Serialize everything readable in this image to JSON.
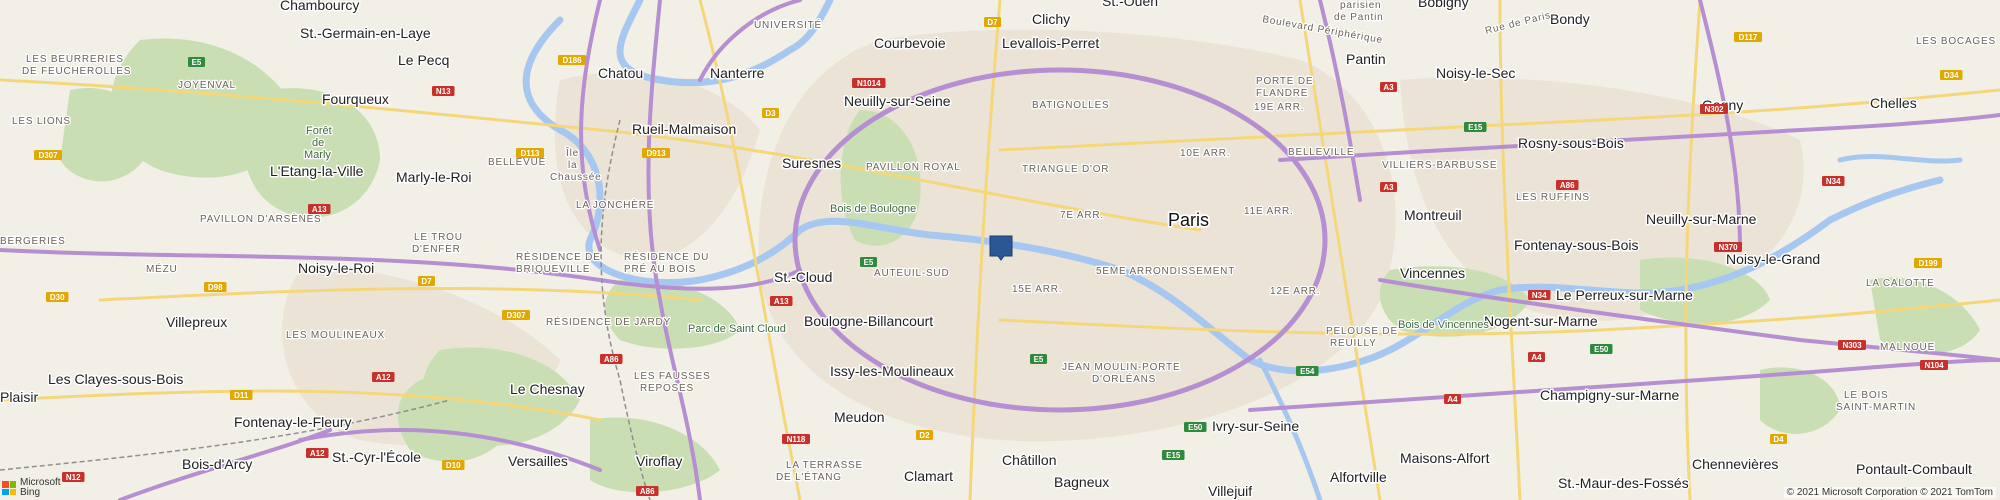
{
  "map": {
    "cities": {
      "paris": "Paris",
      "chambourcy": "Chambourcy",
      "st_germain": "St.-Germain-en-Laye",
      "le_pecq": "Le Pecq",
      "fourqueux": "Fourqueux",
      "letang": "L'Etang-la-Ville",
      "marly": "Marly-le-Roi",
      "chatou": "Chatou",
      "nanterre": "Nanterre",
      "courbevoie": "Courbevoie",
      "clichy": "Clichy",
      "st_ouen": "St.-Ouen",
      "levallois": "Levallois-Perret",
      "neuilly_seine": "Neuilly-sur-Seine",
      "rueil": "Rueil-Malmaison",
      "suresnes": "Suresnes",
      "st_cloud": "St.-Cloud",
      "boulogne": "Boulogne-Billancourt",
      "issy": "Issy-les-Moulineaux",
      "meudon": "Meudon",
      "clamart": "Clamart",
      "chatillon": "Châtillon",
      "bagneux": "Bagneux",
      "villejuif": "Villejuif",
      "ivry": "Ivry-sur-Seine",
      "alfortville": "Alfortville",
      "maisons_alfort": "Maisons-Alfort",
      "vincennes": "Vincennes",
      "montreuil": "Montreuil",
      "pantin": "Pantin",
      "noisy_sec": "Noisy-le-Sec",
      "bobigny": "Bobigny",
      "bondy": "Bondy",
      "rosny": "Rosny-sous-Bois",
      "gagny": "Gagny",
      "chelles": "Chelles",
      "neuilly_marne": "Neuilly-sur-Marne",
      "fontenay_bois": "Fontenay-sous-Bois",
      "noisy_grand": "Noisy-le-Grand",
      "perreux": "Le Perreux-sur-Marne",
      "nogent": "Nogent-sur-Marne",
      "champigny": "Champigny-sur-Marne",
      "chennevieres": "Chennevières",
      "st_maur": "St.-Maur-des-Fossés",
      "pontault": "Pontault-Combault",
      "noisy_roi": "Noisy-le-Roi",
      "villepreux": "Villepreux",
      "clayes": "Les Clayes-sous-Bois",
      "plaisir": "Plaisir",
      "fontenay_fleury": "Fontenay-le-Fleury",
      "bois_arcy": "Bois-d'Arcy",
      "st_cyr": "St.-Cyr-l'École",
      "versailles": "Versailles",
      "viroflay": "Viroflay",
      "le_chesnay": "Le Chesnay"
    },
    "districts": {
      "universite": "UNIVERSITÉ",
      "beurreries": "LES BEURRERIES",
      "feucherolles": "DE FEUCHEROLLES",
      "joyenval": "JOYENVAL",
      "les_lions": "LES LIONS",
      "bergeries": "BERGERIES",
      "bellevue": "BELLEVUE",
      "chaussee_1": "Île",
      "chaussee_2": "la",
      "chaussee_3": "Chaussée",
      "pavillon_royal": "PAVILLON ROYAL",
      "triangle_or": "TRIANGLE D'OR",
      "batignolles": "BATIGNOLLES",
      "arr10": "10E ARR.",
      "arr19": "19E ARR.",
      "belleville": "BELLEVILLE",
      "arr11": "11E ARR.",
      "arr7": "7E ARR.",
      "arr12": "12E ARR.",
      "arr15": "15E ARR.",
      "arr5": "5EME ARRONDISSEMENT",
      "auteuil": "AUTEUIL-SUD",
      "jean_moulin_1": "JEAN MOULIN-PORTE",
      "jean_moulin_2": "D'ORLÉANS",
      "pelouse_1": "PELOUSE DE",
      "pelouse_2": "REUILLY",
      "la_joncher": "LA JONCHÈRE",
      "briqueville_1": "RÉSIDENCE DE",
      "briqueville_2": "BRIQUEVILLE",
      "pre_bois_1": "RÉSIDENCE DU",
      "pre_bois_2": "PRÉ AU BOIS",
      "jardy": "RÉSIDENCE DE JARDY",
      "moulineaux": "LES MOULINEAUX",
      "trou_1": "LE TROU",
      "trou_2": "D'ENFER",
      "fausses_1": "LES FAUSSES",
      "fausses_2": "REPOSES",
      "pavillon_arsenes": "PAVILLON D'ARSÈNES",
      "mezu": "MÉZU",
      "porte_flandre_1": "PORTE DE",
      "porte_flandre_2": "FLANDRE",
      "villiers_barbusse": "VILLIERS-BARBUSSE",
      "les_ruffins": "LES RUFFINS",
      "la_calotte": "LA CALOTTE",
      "malnoue": "MALNOUE",
      "bois_st_martin_1": "LE BOIS",
      "bois_st_martin_2": "SAINT-MARTIN",
      "bocages_1": "LES BOCAGES",
      "terrasse_1": "LA TERRASSE",
      "terrasse_2": "DE L'ÉTANG",
      "parisien_1": "parisien",
      "parisien_2": "de Pantin"
    },
    "parks": {
      "bois_boulogne": "Bois de Boulogne",
      "parc_st_cloud": "Parc de Saint Cloud",
      "bois_vincennes": "Bois de Vincennes",
      "foret_1": "Forêt",
      "foret_2": "de",
      "foret_3": "Marly"
    },
    "roads": {
      "e5_1": "E5",
      "e5_2": "E5",
      "e5_3": "E5",
      "n13": "N13",
      "d186": "D186",
      "d7a": "D7",
      "d7b": "D7",
      "n1014": "N1014",
      "d3": "D3",
      "d913": "D913",
      "d113": "D113",
      "d307a": "D307",
      "d307b": "D307",
      "a13a": "A13",
      "a13b": "A13",
      "a86a": "A86",
      "a86b": "A86",
      "a86c": "A86",
      "d98": "D98",
      "d30": "D30",
      "d11": "D11",
      "a12": "A12",
      "n12": "N12",
      "d10": "D10",
      "n118": "N118",
      "d2": "D2",
      "e50a": "E50",
      "e50b": "E50",
      "e15a": "E15",
      "e15b": "E15",
      "e54": "E54",
      "a3": "A3",
      "a3b": "A3",
      "n302": "N302",
      "d117": "D117",
      "d34": "D34",
      "n34": "N34",
      "n370": "N370",
      "d199": "D199",
      "n303": "N303",
      "n104": "N104",
      "a4a": "A4",
      "a4b": "A4",
      "d4": "D4",
      "n34b": "N34",
      "d20": "D20",
      "d934": "D934"
    },
    "street_names": {
      "blvd_peripherique": "Boulevard Périphérique",
      "rue_paris": "Rue de Paris"
    }
  },
  "marker": {
    "label": "location-pin",
    "color": "#2b5797"
  },
  "footer": {
    "brand_top": "Microsoft",
    "brand_bottom": "Bing",
    "copyright": "© 2021 Microsoft Corporation © 2021 TomTom"
  },
  "colors": {
    "land": "#f2efe6",
    "park": "#c9dfb3",
    "water": "#a6c8f0",
    "motorway": "#b58fd1",
    "major_road": "#f4d77a",
    "urban": "#ebe6da"
  }
}
